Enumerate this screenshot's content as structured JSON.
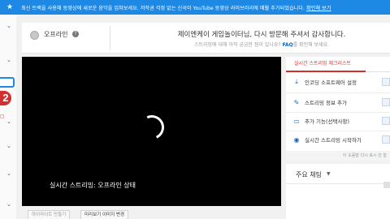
{
  "banner": {
    "icon": "star-icon",
    "text": "최신 트랙을 사용해 동영상에 새로운 음악을 입혀보세요. 저작권 걱정 없는 신곡이 YouTube 동영상 라이브러리에 매월 추가되었습니다.",
    "link": "확인해 보기"
  },
  "sidebar": {
    "badge": "2"
  },
  "status": {
    "label": "오프라인",
    "help": "?",
    "message": "제이엔케이 게임놀이터님, 다시 방문해 주셔서 감사합니다.",
    "sub_message": "스트리밍에 대해 아직 궁금한 점이 있나요?",
    "faq": "FAQ",
    "sub_suffix": "를 확인해 보세요."
  },
  "player": {
    "caption": "실시간 스트리밍: 오프라인 상태"
  },
  "buttons": {
    "highlight": "하이라이트 만들기",
    "thumbnail": "미리보기 이미지 변경"
  },
  "checklist": {
    "tab": "실시간 스트리밍 체크리스트",
    "items": [
      {
        "icon": "download-icon",
        "label": "인코딩 소프트웨어 설정"
      },
      {
        "icon": "edit-icon",
        "label": "스트리밍 정보 추가"
      },
      {
        "icon": "card-icon",
        "label": "추가 기능(선택사항)"
      },
      {
        "icon": "broadcast-icon",
        "label": "실시간 스트리밍 시작하기"
      }
    ],
    "footer": "이 도움말 다시 표시 안 함"
  },
  "chat": {
    "title": "주요 채팅",
    "caret": "▼"
  },
  "colors": {
    "banner": "#1e88e5",
    "accent_red": "#d32f2f",
    "link_blue": "#1565c0"
  }
}
